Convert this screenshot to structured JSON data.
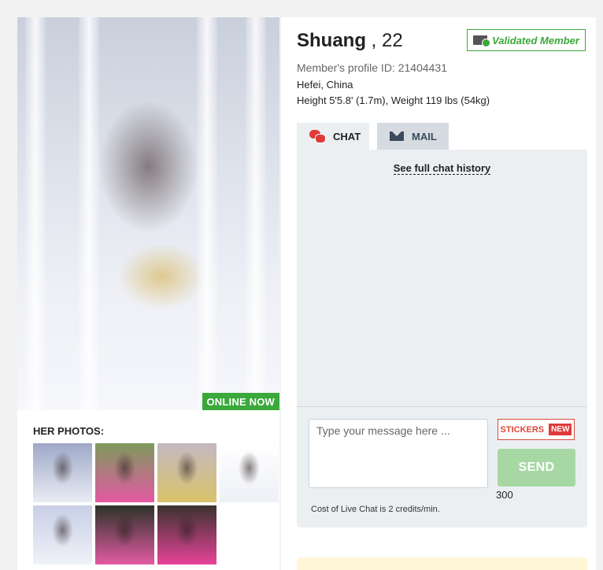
{
  "profile": {
    "name": "Shuang",
    "age": "22",
    "validated_label": "Validated Member",
    "profile_id_text": "Member's profile ID: 21404431",
    "location": "Hefei, China",
    "measurements": "Height 5'5.8' (1.7m), Weight 119 lbs (54kg)"
  },
  "photo": {
    "online_label": "ONLINE NOW",
    "photos_heading": "HER PHOTOS:",
    "thumb_colors": [
      [
        "#9fa8c8",
        "#e9ecf3"
      ],
      [
        "#7d9a5c",
        "#e35aa3"
      ],
      [
        "#c4b8c2",
        "#d9c36a"
      ],
      [
        "#ffffff",
        "#eef0f6"
      ],
      [
        "#c8cfe6",
        "#f0f2f8"
      ],
      [
        "#2c3328",
        "#e35aa3"
      ],
      [
        "#3b332e",
        "#e7439a"
      ]
    ]
  },
  "tabs": {
    "chat_label": "CHAT",
    "mail_label": "MAIL"
  },
  "chat": {
    "history_link": "See full chat history",
    "placeholder": "Type your message here ...",
    "stickers_label": "STICKERS",
    "new_badge": "NEW",
    "send_label": "SEND",
    "char_count": "300",
    "cost_note": "Cost of Live Chat is 2 credits/min."
  },
  "colors": {
    "accent_green": "#3aa83a",
    "send_green": "#a7d8a4",
    "alert_red": "#e03a3a",
    "panel_bg": "#eceff2"
  }
}
